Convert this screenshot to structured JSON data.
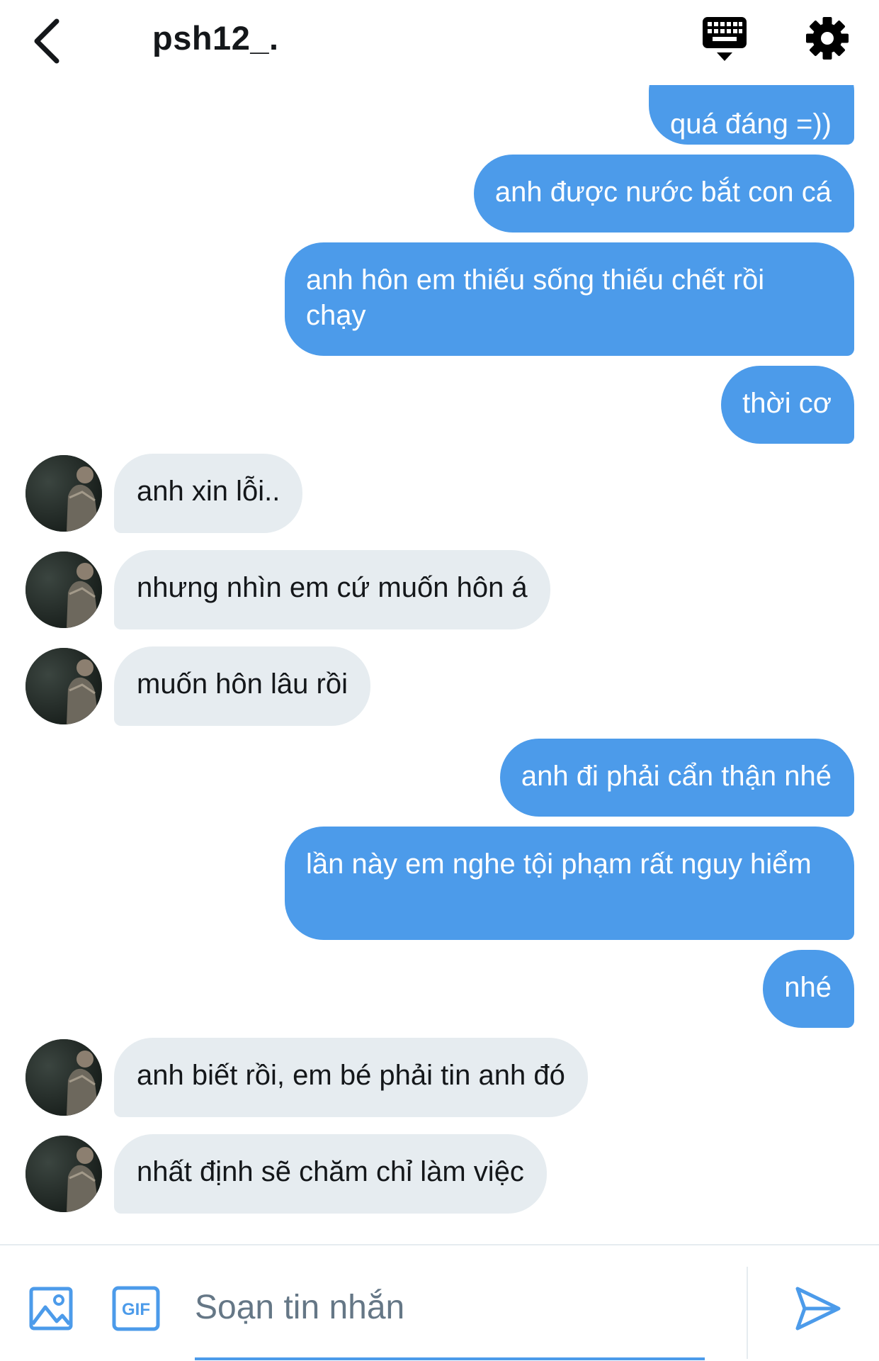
{
  "header": {
    "username": "psh12_."
  },
  "messages": [
    {
      "side": "sent",
      "text": "quá đáng =))"
    },
    {
      "side": "sent",
      "text": "anh được nước bắt con cá"
    },
    {
      "side": "sent",
      "text": "anh hôn em thiếu sống thiếu chết rồi chạy"
    },
    {
      "side": "sent",
      "text": "thời cơ"
    },
    {
      "side": "recv",
      "text": "anh xin lỗi.."
    },
    {
      "side": "recv",
      "text": "nhưng nhìn em cứ muốn hôn á"
    },
    {
      "side": "recv",
      "text": "muốn hôn lâu rồi"
    },
    {
      "side": "sent",
      "text": "anh đi phải cẩn thận nhé"
    },
    {
      "side": "sent",
      "text": "lần này em nghe tội phạm rất nguy hiểm"
    },
    {
      "side": "sent",
      "text": "nhé"
    },
    {
      "side": "recv",
      "text": "anh biết rồi, em bé phải tin anh đó"
    },
    {
      "side": "recv",
      "text": "nhất định sẽ chăm chỉ làm việc"
    }
  ],
  "composer": {
    "placeholder": "Soạn tin nhắn",
    "gif_label": "GIF"
  },
  "icons": {
    "back": "chevron-left-icon",
    "keyboard": "keyboard-icon",
    "settings": "gear-icon",
    "image": "image-icon",
    "gif": "gif-icon",
    "send": "send-icon"
  },
  "colors": {
    "sent_bubble": "#4c9bea",
    "received_bubble": "#e6ecf0",
    "accent": "#4c9bea"
  }
}
